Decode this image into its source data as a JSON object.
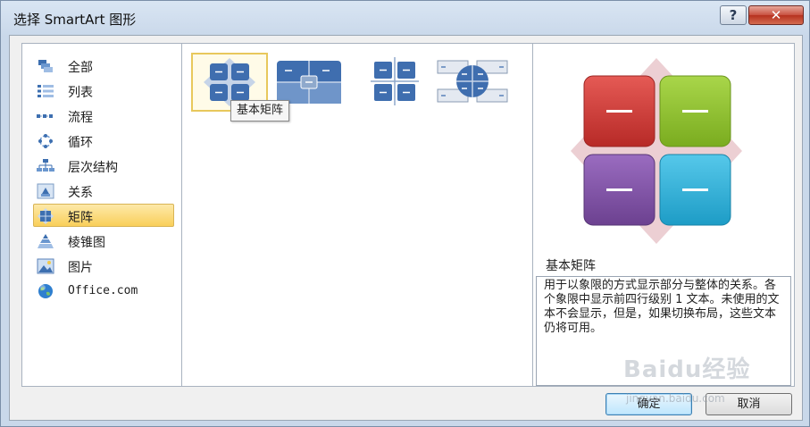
{
  "window": {
    "title": "选择 SmartArt 图形",
    "help_label": "?",
    "close_label": "✕"
  },
  "categories": [
    {
      "label": "全部",
      "icon": "all-icon"
    },
    {
      "label": "列表",
      "icon": "list-icon"
    },
    {
      "label": "流程",
      "icon": "process-icon"
    },
    {
      "label": "循环",
      "icon": "cycle-icon"
    },
    {
      "label": "层次结构",
      "icon": "hierarchy-icon"
    },
    {
      "label": "关系",
      "icon": "relationship-icon"
    },
    {
      "label": "矩阵",
      "icon": "matrix-icon",
      "selected": true
    },
    {
      "label": "棱锥图",
      "icon": "pyramid-icon"
    },
    {
      "label": "图片",
      "icon": "picture-icon"
    },
    {
      "label": "Office.com",
      "icon": "globe-icon"
    }
  ],
  "gallery": {
    "tooltip": "基本矩阵",
    "items": [
      "basic-matrix",
      "titled-matrix",
      "grid-matrix",
      "cycle-matrix"
    ]
  },
  "preview": {
    "title": "基本矩阵",
    "description": "用于以象限的方式显示部分与整体的关系。各个象限中显示前四行级别 1 文本。未使用的文本不会显示，但是，如果切换布局，这些文本仍将可用。"
  },
  "buttons": {
    "ok": "确定",
    "cancel": "取消"
  },
  "watermark": {
    "text": "Baidu经验",
    "sub": "jingyan.baidu.com"
  },
  "colors": {
    "selection": "#f9cf5a",
    "tile_red": "#c8322f",
    "tile_green": "#8dbf2a",
    "tile_purple": "#7c4f9e",
    "tile_cyan": "#2ab0d8",
    "thumb_blue": "#3f6eaf"
  }
}
